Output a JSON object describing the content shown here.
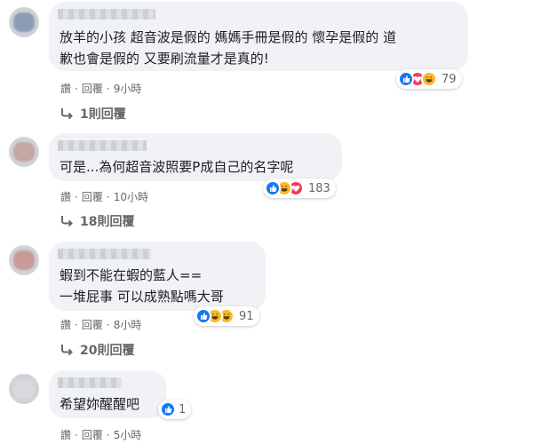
{
  "comments": [
    {
      "text": "放羊的小孩  超音波是假的  媽媽手冊是假的  懷孕是假的  道\n歉也會是假的  又要刷流量才是真的!",
      "reactions": [
        "like",
        "love",
        "haha"
      ],
      "reaction_count": "79",
      "actions": {
        "reply": "讚",
        "sep1": "·",
        "reply2": "回覆",
        "sep2": "·",
        "time": "9小時"
      },
      "replies_label": "1則回覆"
    },
    {
      "text": "可是...為何超音波照要P成自己的名字呢",
      "reactions": [
        "like",
        "haha",
        "love"
      ],
      "reaction_count": "183",
      "actions": {
        "reply": "讚",
        "sep1": "·",
        "reply2": "回覆",
        "sep2": "·",
        "time": "10小時"
      },
      "replies_label": "18則回覆"
    },
    {
      "text": "蝦到不能在蝦的藍人==\n一堆屁事  可以成熟點嗎大哥",
      "reactions": [
        "like",
        "haha",
        "haha"
      ],
      "reaction_count": "91",
      "actions": {
        "reply": "讚",
        "sep1": "·",
        "reply2": "回覆",
        "sep2": "·",
        "time": "8小時"
      },
      "replies_label": "20則回覆"
    },
    {
      "text": "希望妳醒醒吧",
      "reactions": [
        "like"
      ],
      "reaction_count": "1",
      "actions": {
        "reply": "讚",
        "sep1": "·",
        "reply2": "回覆",
        "sep2": "·",
        "time": "5小時"
      },
      "replies_label": ""
    }
  ],
  "colors": {
    "like": "#1877f2",
    "love": "#f33e58",
    "haha": "#f7b928",
    "bubble": "#f0f2f5",
    "meta_text": "#65676b"
  }
}
